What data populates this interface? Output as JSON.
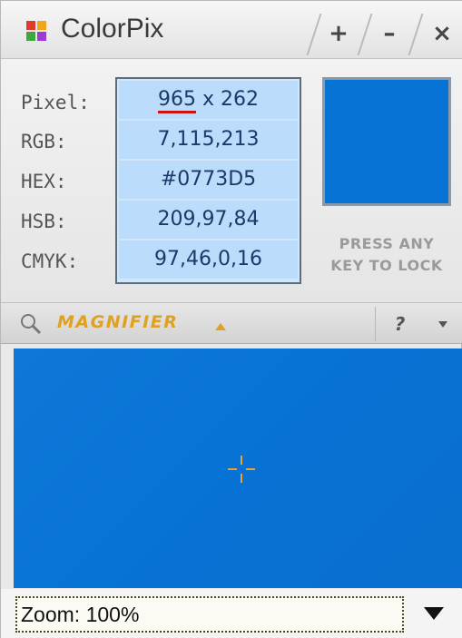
{
  "app": {
    "title": "ColorPix"
  },
  "titlebar": {
    "add_label": "+",
    "minimize_label": "–",
    "close_label": "×"
  },
  "info": {
    "labels": [
      "Pixel:",
      "RGB:",
      "HEX:",
      "HSB:",
      "CMYK:"
    ],
    "pixel": {
      "x": "965",
      "separator": " x ",
      "y": "262"
    },
    "rgb": "7,115,213",
    "hex": "#0773D5",
    "hsb": "209,97,84",
    "cmyk": "97,46,0,16"
  },
  "swatch": {
    "color": "#0773D5"
  },
  "lock_hint": {
    "line1": "PRESS ANY",
    "line2": "KEY TO LOCK"
  },
  "magnifier": {
    "label": "MAGNIFIER",
    "help_label": "?"
  },
  "zoom": {
    "value": "Zoom: 100%"
  },
  "colors": {
    "accent": "#e0a020",
    "crosshair": "#e8a23a",
    "underline": "#cc1111"
  }
}
